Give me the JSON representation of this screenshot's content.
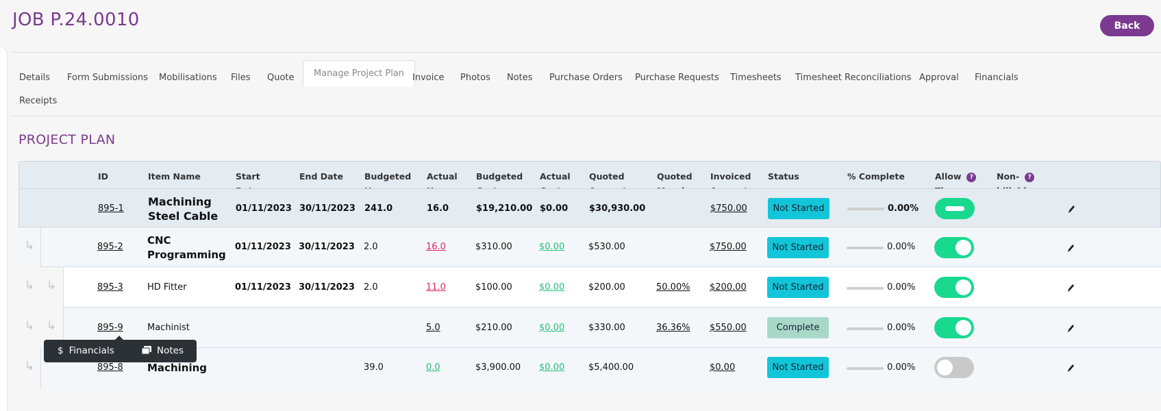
{
  "header": {
    "job_title": "JOB P.24.0010",
    "back_label": "Back"
  },
  "tabs": [
    "Details",
    "Form Submissions",
    "Mobilisations",
    "Files",
    "Quote",
    "Manage Project Plan",
    "Invoice",
    "Photos",
    "Notes",
    "Purchase Orders",
    "Purchase Requests",
    "Timesheets",
    "Timesheet Reconciliations",
    "Approval",
    "Financials",
    "Receipts"
  ],
  "active_tab": "Manage Project Plan",
  "section_title": "PROJECT PLAN",
  "columns": {
    "id": "ID",
    "item_name": "Item Name",
    "start_date": [
      "Start",
      "Date"
    ],
    "end_date": "End Date",
    "budgeted_hours": [
      "Budgeted",
      "Hours"
    ],
    "actual_hours": [
      "Actual",
      "Hours"
    ],
    "budgeted_cost": [
      "Budgeted",
      "Cost"
    ],
    "actual_cost": [
      "Actual",
      "Cost"
    ],
    "quoted_amount": [
      "Quoted",
      "Amount"
    ],
    "quoted_margin": [
      "Quoted",
      "Margin"
    ],
    "invoiced_amount": [
      "Invoiced",
      "Amount"
    ],
    "status": "Status",
    "pct_complete": "% Complete",
    "allow_times": [
      "Allow",
      "Times"
    ],
    "non_billable": [
      "Non-",
      "billable"
    ],
    "help_mark": "?"
  },
  "rows": [
    {
      "id": "895-1",
      "name": "Machining Steel Cable",
      "start": "01/11/2023",
      "end": "30/11/2023",
      "budgeted_hours": "241.0",
      "actual_hours": "16.0",
      "budgeted_cost": "$19,210.00",
      "actual_cost": "$0.00",
      "quoted_amount": "$30,930.00",
      "quoted_margin": "",
      "invoiced_amount": "$750.00",
      "status": "Not Started",
      "pct": "0.00%",
      "progress": 0,
      "allow_times": "on"
    },
    {
      "id": "895-2",
      "name": "CNC Programming",
      "start": "01/11/2023",
      "end": "30/11/2023",
      "budgeted_hours": "2.0",
      "actual_hours": "16.0",
      "budgeted_cost": "$310.00",
      "actual_cost": "$0.00",
      "quoted_amount": "$530.00",
      "quoted_margin": "",
      "invoiced_amount": "$750.00",
      "status": "Not Started",
      "pct": "0.00%",
      "progress": 0,
      "allow_times": "on"
    },
    {
      "id": "895-3",
      "name": "HD Fitter",
      "start": "01/11/2023",
      "end": "30/11/2023",
      "budgeted_hours": "2.0",
      "actual_hours": "11.0",
      "budgeted_cost": "$100.00",
      "actual_cost": "$0.00",
      "quoted_amount": "$200.00",
      "quoted_margin": "50.00%",
      "invoiced_amount": "$200.00",
      "status": "Not Started",
      "pct": "0.00%",
      "progress": 0,
      "allow_times": "on"
    },
    {
      "id": "895-9",
      "name": "Machinist",
      "start": "",
      "end": "",
      "budgeted_hours": "",
      "actual_hours": "5.0",
      "budgeted_cost": "$210.00",
      "actual_cost": "$0.00",
      "quoted_amount": "$330.00",
      "quoted_margin": "36.36%",
      "invoiced_amount": "$550.00",
      "status": "Complete",
      "pct": "0.00%",
      "progress": 0,
      "allow_times": "on"
    },
    {
      "id": "895-8",
      "name": "Machining",
      "start": "",
      "end": "",
      "budgeted_hours": "39.0",
      "actual_hours": "0.0",
      "budgeted_cost": "$3,900.00",
      "actual_cost": "$0.00",
      "quoted_amount": "$5,400.00",
      "quoted_margin": "",
      "invoiced_amount": "$0.00",
      "status": "Not Started",
      "pct": "0.00%",
      "progress": 0,
      "allow_times": "off"
    }
  ],
  "tooltip": {
    "financials_icon": "$",
    "financials_label": "Financials",
    "notes_label": "Notes"
  },
  "icons": {
    "indent_arrow": "↳",
    "pencil": "pencil-icon"
  },
  "colors": {
    "brand": "#7b3a8f",
    "status_not_started": "#13c5d8",
    "status_complete": "#a9d8c8",
    "toggle_on": "#19d98f",
    "over_budget": "#e0245e",
    "under_budget": "#22c07a"
  }
}
